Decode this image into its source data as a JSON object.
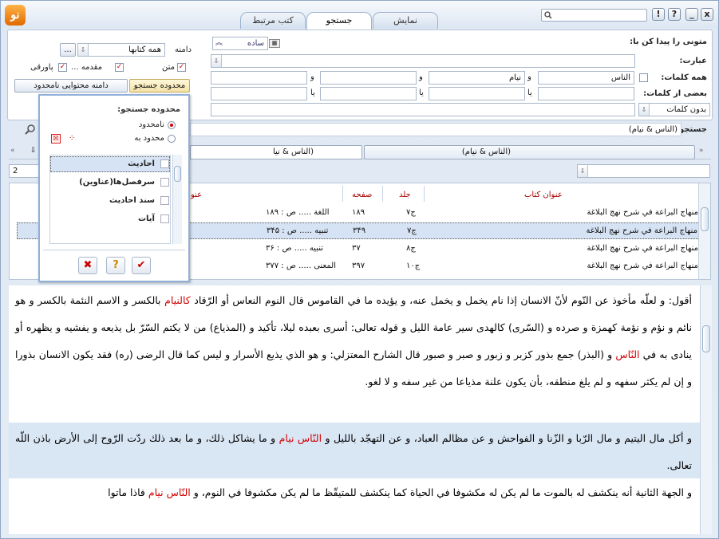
{
  "window": {
    "tabs": [
      {
        "label": "کتب مرتبط",
        "active": false
      },
      {
        "label": "جستجو",
        "active": true
      },
      {
        "label": "نمایش",
        "active": false
      }
    ],
    "controls": {
      "help": "?",
      "info": "!",
      "minimize": "_",
      "close": "x"
    }
  },
  "search": {
    "title": "متونی را پیدا کن با:",
    "mode": "ساده",
    "phrase_label": "عبارت:",
    "all_words_label": "همه کلمات:",
    "some_words_label": "بعضی از کلمات:",
    "all_words": [
      "الناس",
      "نیام",
      "",
      ""
    ],
    "and_sep": "و",
    "or_sep": "یا",
    "no_words_value": "بدون کلمات",
    "scope_label": "دامنه",
    "scope_value": "همه کتابها",
    "ellipsis": "...",
    "options": {
      "matn": "متن",
      "muqaddama": "مقدمه ...",
      "pavaraghi": "پاورقی"
    },
    "range_button": "محدوده جستجو",
    "content_range_button": "دامنه محتوایی نامحدود",
    "query_label": "جستجو:",
    "query_value": "(الناس & نیام)",
    "result_tab_label": "(الناس & نیام)",
    "result_tab2_label": "(الناس & نیا",
    "count": "2"
  },
  "popup": {
    "title": "محدوده جستجو:",
    "unlimited": "نامحدود",
    "limited": "محدود به",
    "items": [
      "احادیث",
      "سرفصل‌ها(عناوین)",
      "سند احادیث",
      "آیات"
    ],
    "selected_item_index": 0
  },
  "results": {
    "headers": {
      "book": "عنوان کتاب",
      "volume": "جلد",
      "page": "صفحه",
      "title": "عنو"
    },
    "rows": [
      {
        "book": "منهاج البراعة في شرح نهج البلاغة",
        "volume": "ج۷",
        "page": "۱۸۹",
        "title": "اللغة ..... ص : ۱۸۹"
      },
      {
        "book": "منهاج البراعة في شرح نهج البلاغة",
        "volume": "ج۷",
        "page": "۳۴۹",
        "title": "تنبیه ..... ص : ۳۴۵"
      },
      {
        "book": "منهاج البراعة في شرح نهج البلاغة",
        "volume": "ج۸",
        "page": "۳۷",
        "title": "تنبیه ..... ص : ۳۶"
      },
      {
        "book": "منهاج البراعة في شرح نهج البلاغة",
        "volume": "ج۱۰",
        "page": "۳۹۷",
        "title": "المعنى ..... ص : ۳۷۷"
      }
    ],
    "selected_row_index": 1
  },
  "text": {
    "para1_a": "أقول: و لعلّه مأخوذ عن النّوم لأنّ الانسان إذا نام يخمل و يخمل عنه، و يؤيده ما في القاموس قال النوم النعاس أو الرّقاد ",
    "para1_hl": "كالنيام",
    "para1_b": " بالكسر و الاسم النئمة بالكسر و هو نائم و نؤم و نؤمة كهمزة و صرده و (السّرى) كالهدى سير عامة الليل و قوله تعالى: أسرى بعبده ليلا، تأكيد و (المذياع) من لا يكتم السّرّ بل يذيعه و يفشيه و يظهره أو ينادى به في ",
    "para1_hl2": "النّاس",
    "para1_c": " و (البذر) جمع بذور كزبر و زبور و صبر و صبور قال الشارح المعتزلي: و هو الذي يذيع الأسرار و ليس كما قال الرضى (ره) فقد يكون الانسان بذورا و إن لم يكثر سفهه و لم يلغ منطقه، بأن يكون علنة مذياعا من غير سفه و لا لغو.",
    "para2_a": "و أكل مال اليتيم و مال الرّبا و الزّنا و الفواحش و عن مظالم العباد، و عن التهجّد بالليل و ",
    "para2_hl": "النّاس نيام",
    "para2_b": " و ما يشاكل ذلك، و ما بعد ذلك ردّت الرّوح إلى الأرض باذن اللّه تعالى.",
    "para3_a": "و الجهة الثانية أنه ينكشف له بالموت ما لم يكن له مكشوفا في الحياة كما ينكشف للمتيقّظ ما لم يكن مكشوفا في النوم، و ",
    "para3_hl": "النّاس نيام",
    "para3_b": " فاذا ماتوا"
  },
  "colors": {
    "highlight": "#d10000",
    "selection": "#d6e3f4",
    "accent": "#8fb0d8"
  }
}
